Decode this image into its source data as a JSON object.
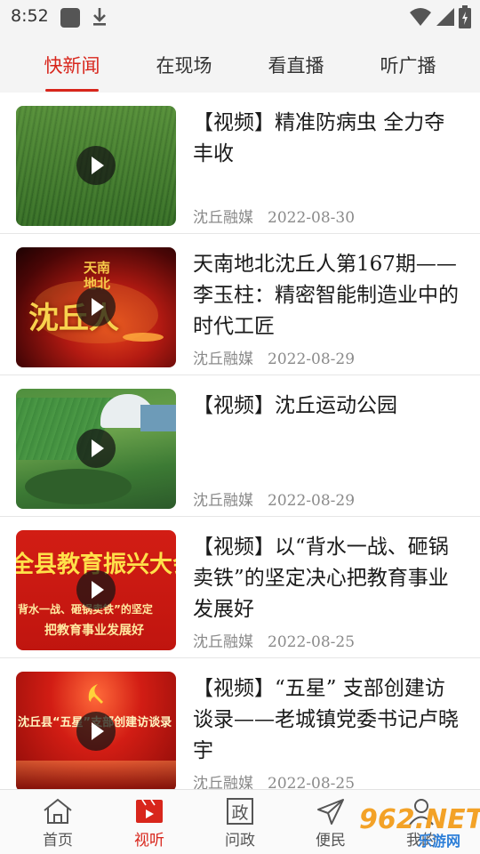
{
  "status_bar": {
    "time": "8:52"
  },
  "tabs": [
    {
      "label": "快新闻",
      "active": true
    },
    {
      "label": "在现场",
      "active": false
    },
    {
      "label": "看直播",
      "active": false
    },
    {
      "label": "听广播",
      "active": false
    }
  ],
  "news": [
    {
      "title": "【视频】精准防病虫 全力夺丰收",
      "source": "沈丘融媒",
      "date": "2022-08-30",
      "thumb_theme": "green-field"
    },
    {
      "title": "天南地北沈丘人第167期——李玉柱：精密智能制造业中的时代工匠",
      "source": "沈丘融媒",
      "date": "2022-08-29",
      "thumb_theme": "red-map",
      "thumb_text": [
        "天南",
        "地北",
        "沈丘人"
      ]
    },
    {
      "title": "【视频】沈丘运动公园",
      "source": "沈丘融媒",
      "date": "2022-08-29",
      "thumb_theme": "park-aerial"
    },
    {
      "title": "【视频】以“背水一战、砸锅卖铁”的坚定决心把教育事业发展好",
      "source": "沈丘融媒",
      "date": "2022-08-25",
      "thumb_theme": "red-banner",
      "thumb_text": [
        "全县教育振兴大会",
        "背水一战、砸锅卖铁”的坚定",
        "把教育事业发展好"
      ]
    },
    {
      "title": "【视频】“五星” 支部创建访谈录——老城镇党委书记卢晓宇",
      "source": "沈丘融媒",
      "date": "2022-08-25",
      "thumb_theme": "party-red",
      "thumb_text": [
        "沈丘县“五星”支部创建访谈录"
      ]
    }
  ],
  "bottom_nav": [
    {
      "label": "首页",
      "icon": "home-icon",
      "active": false
    },
    {
      "label": "视听",
      "icon": "video-icon",
      "active": true
    },
    {
      "label": "问政",
      "icon": "government-icon",
      "active": false
    },
    {
      "label": "便民",
      "icon": "send-icon",
      "active": false
    },
    {
      "label": "我的",
      "icon": "user-icon",
      "active": false
    }
  ],
  "watermark": {
    "main": "962.NET",
    "sub": "乐游网"
  },
  "colors": {
    "accent": "#d8261c",
    "tab_bar_bg": "#f4f4f4",
    "meta_text": "#8a8a8a"
  }
}
